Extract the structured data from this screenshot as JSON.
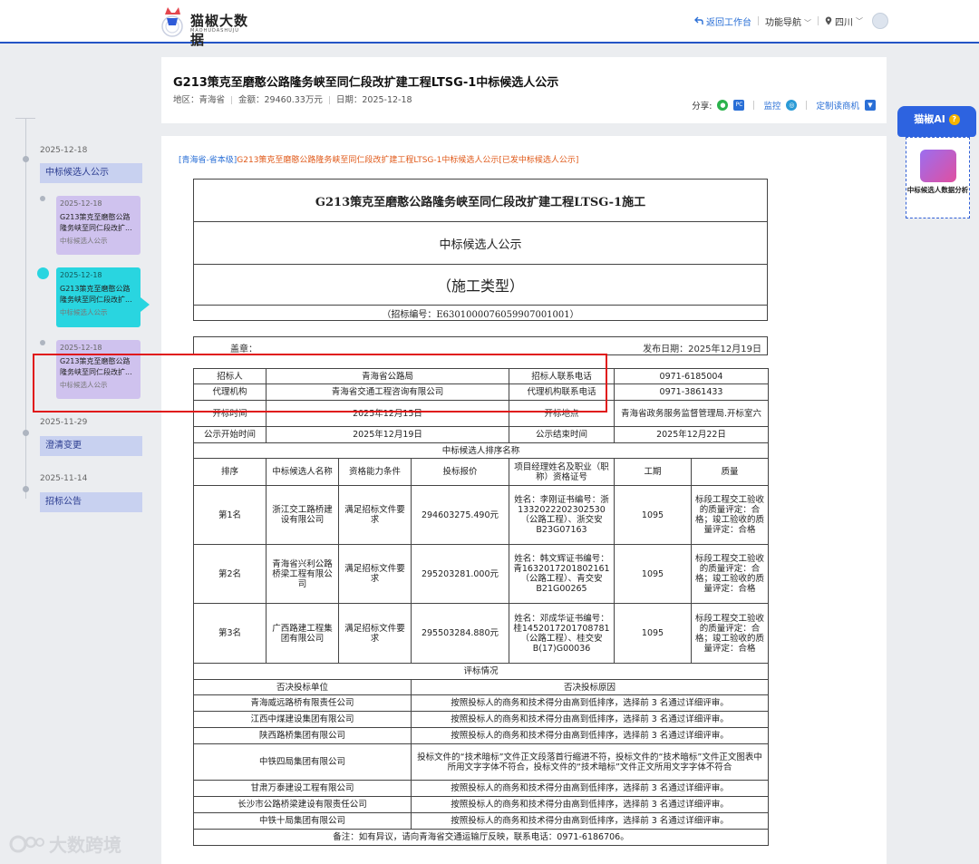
{
  "topbar": {
    "logo_title": "猫椒大数据",
    "logo_sub": "MAOHUDASHUJU",
    "back_label": "返回工作台",
    "nav_label": "功能导航",
    "region_label": "四川"
  },
  "header": {
    "title": "G213策克至磨憨公路隆务峡至同仁段改扩建工程LTSG-1中标候选人公示",
    "region": "地区：青海省",
    "amount": "金额：29460.33万元",
    "date": "日期：2025-12-18",
    "share_label": "分享:",
    "monitor_label": "监控",
    "custom_label": "定制读商机"
  },
  "timeline": {
    "items": [
      {
        "date": "2025-12-18",
        "label": "中标候选人公示"
      },
      {
        "date": "2025-11-29",
        "label": "澄清变更"
      },
      {
        "date": "2025-11-14",
        "label": "招标公告"
      }
    ],
    "cards": [
      {
        "date": "2025-12-18",
        "title": "G213策克至磨憨公路隆务峡至同仁段改扩...",
        "sub": "中标候选人公示"
      },
      {
        "date": "2025-12-18",
        "title": "G213策克至磨憨公路隆务峡至同仁段改扩...",
        "sub": "中标候选人公示"
      },
      {
        "date": "2025-12-18",
        "title": "G213策克至磨憨公路隆务峡至同仁段改扩...",
        "sub": "中标候选人公示"
      }
    ]
  },
  "ai": {
    "title": "猫椒AI",
    "label": "中标候选人数据分析"
  },
  "doc": {
    "crumb_blue": "[青海省-省本级]",
    "crumb_rest": "G213策克至磨憨公路隆务峡至同仁段改扩建工程LTSG-1中标候选人公示[已发中标候选人公示]",
    "head_rows": [
      "G213策克至磨憨公路隆务峡至同仁段改扩建工程LTSG-1施工",
      "中标候选人公示",
      "（施工类型）",
      "（招标编号：E6301000076059907001001）"
    ],
    "seal_label": "盖章：",
    "publish_date": "发布日期：2025年12月19日"
  },
  "info": {
    "r1": [
      "招标人",
      "青海省公路局",
      "招标人联系电话",
      "0971-6185004"
    ],
    "r2": [
      "代理机构",
      "青海省交通工程咨询有限公司",
      "代理机构联系电话",
      "0971-3861433"
    ],
    "r3": [
      "开标时间",
      "2025年12月15日",
      "开标地点",
      "青海省政务服务监督管理局.开标室六"
    ],
    "r4": [
      "公示开始时间",
      "2025年12月19日",
      "公示结束时间",
      "2025年12月22日"
    ],
    "rank_title": "中标候选人排序名称",
    "cols": [
      "排序",
      "中标候选人名称",
      "资格能力条件",
      "投标报价",
      "项目经理姓名及职业（职称）资格证号",
      "工期",
      "质量"
    ]
  },
  "candidates": [
    {
      "rank": "第1名",
      "name": "浙江交工路桥建设有限公司",
      "qual": "满足招标文件要求",
      "price": "294603275.490元",
      "pm": "姓名：李刚证书编号：浙1332022202302530（公路工程）、浙交安B23G07163",
      "period": "1095",
      "quality": "标段工程交工验收的质量评定：合格；竣工验收的质量评定：合格"
    },
    {
      "rank": "第2名",
      "name": "青海省兴利公路桥梁工程有限公司",
      "qual": "满足招标文件要求",
      "price": "295203281.000元",
      "pm": "姓名：韩文辉证书编号：青1632017201802161（公路工程）、青交安B21G00265",
      "period": "1095",
      "quality": "标段工程交工验收的质量评定：合格；竣工验收的质量评定：合格"
    },
    {
      "rank": "第3名",
      "name": "广西路建工程集团有限公司",
      "qual": "满足招标文件要求",
      "price": "295503284.880元",
      "pm": "姓名：邓成华证书编号：桂1452017201708781（公路工程）、桂交安B(17)G00036",
      "period": "1095",
      "quality": "标段工程交工验收的质量评定：合格；竣工验收的质量评定：合格"
    }
  ],
  "review": {
    "title": "评标情况",
    "col_unit": "否决投标单位",
    "col_reason": "否决投标原因",
    "rows": [
      {
        "unit": "青海威远路桥有限责任公司",
        "reason": "按照投标人的商务和技术得分由高到低排序，选择前 3 名通过详细评审。"
      },
      {
        "unit": "江西中煤建设集团有限公司",
        "reason": "按照投标人的商务和技术得分由高到低排序，选择前 3 名通过详细评审。"
      },
      {
        "unit": "陕西路桥集团有限公司",
        "reason": "按照投标人的商务和技术得分由高到低排序，选择前 3 名通过详细评审。"
      },
      {
        "unit": "中铁四局集团有限公司",
        "reason": "投标文件的“技术暗标”文件正文段落首行缩进不符，投标文件的“技术暗标”文件正文图表中所用文字字体不符合，投标文件的“技术暗标”文件正文所用文字字体不符合"
      },
      {
        "unit": "甘肃万泰建设工程有限公司",
        "reason": "按照投标人的商务和技术得分由高到低排序，选择前 3 名通过详细评审。"
      },
      {
        "unit": "长沙市公路桥梁建设有限责任公司",
        "reason": "按照投标人的商务和技术得分由高到低排序，选择前 3 名通过详细评审。"
      },
      {
        "unit": "中铁十局集团有限公司",
        "reason": "按照投标人的商务和技术得分由高到低排序，选择前 3 名通过详细评审。"
      }
    ],
    "note": "备注：如有异议，请向青海省交通运输厅反映，联系电话：0971-6186706。"
  },
  "watermark": "大数跨境"
}
